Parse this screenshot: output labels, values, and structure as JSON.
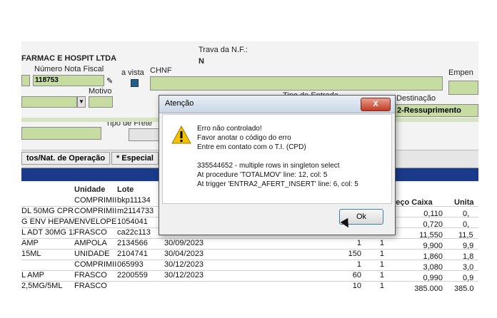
{
  "header": {
    "company": "FARMAC E HOSPIT LTDA",
    "trava_label": "Trava da N.F.:",
    "trava_value": "N",
    "numero_nf_label": "Número Nota Fiscal",
    "numero_nf_value": "118753",
    "a_vista_label": "a vista",
    "chnf_label": "CHNF",
    "empen_label": "Empen",
    "motivo_label": "Motivo",
    "tipo_entrada_label": "Tipo de Entrada",
    "destinacao_label": "Destinação",
    "destinacao_value": "2-Ressuprimento",
    "tipo_frete_label": "Tipo de Frete"
  },
  "tabs": [
    {
      "label": "tos/Nat. de Operação"
    },
    {
      "label": "* Especial"
    }
  ],
  "grid": {
    "headers": {
      "unidade": "Unidade",
      "lote": "Lote",
      "preco": "reço Caixa",
      "unit": "Unita"
    },
    "rows": [
      {
        "prod": "",
        "unidade": "COMPRIMII",
        "lote": "bkp11134",
        "data": "",
        "q1": "",
        "q2": "",
        "preco": "",
        "unit": ""
      },
      {
        "prod": "DL 50MG CPR",
        "unidade": "COMPRIMII",
        "lote": "m2114733",
        "data": "",
        "q1": "",
        "q2": "",
        "preco": "0,110",
        "unit": "0,"
      },
      {
        "prod": "G ENV HEPAMER",
        "unidade": "ENVELOPE",
        "lote": "1054041",
        "data": "",
        "q1": "",
        "q2": "",
        "preco": "0,720",
        "unit": "0,"
      },
      {
        "prod": "L ADT 30MG 120",
        "unidade": "FRASCO",
        "lote": "ca22c113",
        "data": "30/03/2024",
        "q1": "",
        "q2": "",
        "preco": "11,550",
        "unit": "11,5"
      },
      {
        "prod": "AMP",
        "unidade": "AMPOLA",
        "lote": "2134566",
        "data": "30/09/2023",
        "q1": "1",
        "q2": "1",
        "preco": "9,900",
        "unit": "9,9"
      },
      {
        "prod": "15ML",
        "unidade": "UNIDADE",
        "lote": "2104741",
        "data": "30/04/2023",
        "q1": "150",
        "q2": "1",
        "preco": "1,860",
        "unit": "1,8"
      },
      {
        "prod": "",
        "unidade": "COMPRIMII",
        "lote": "065993",
        "data": "30/12/2023",
        "q1": "1",
        "q2": "1",
        "preco": "3,080",
        "unit": "3,0"
      },
      {
        "prod": "L AMP",
        "unidade": "FRASCO",
        "lote": "2200559",
        "data": "30/12/2023",
        "q1": "60",
        "q2": "1",
        "preco": "0,990",
        "unit": "0,9"
      },
      {
        "prod": "2,5MG/5ML",
        "unidade": "FRASCO",
        "lote": "",
        "data": "",
        "q1": "10",
        "q2": "1",
        "preco": "385,000",
        "unit": "385,0"
      }
    ]
  },
  "dialog": {
    "title": "Atenção",
    "close": "X",
    "line1": "Erro não controlado!",
    "line2": "Favor anotar o código do erro",
    "line3": "Entre em contato com o T.I. (CPD)",
    "line4": "335544652 - multiple rows in singleton select",
    "line5": "At procedure 'TOTALMOV' line: 12, col: 5",
    "line6": "At trigger 'ENTRA2_AFERT_INSERT' line: 6, col: 5",
    "ok": "Ok"
  },
  "colors": {
    "field": "#c6dca0",
    "grid_header": "#1a3a8a",
    "warning": "#f2c200"
  }
}
